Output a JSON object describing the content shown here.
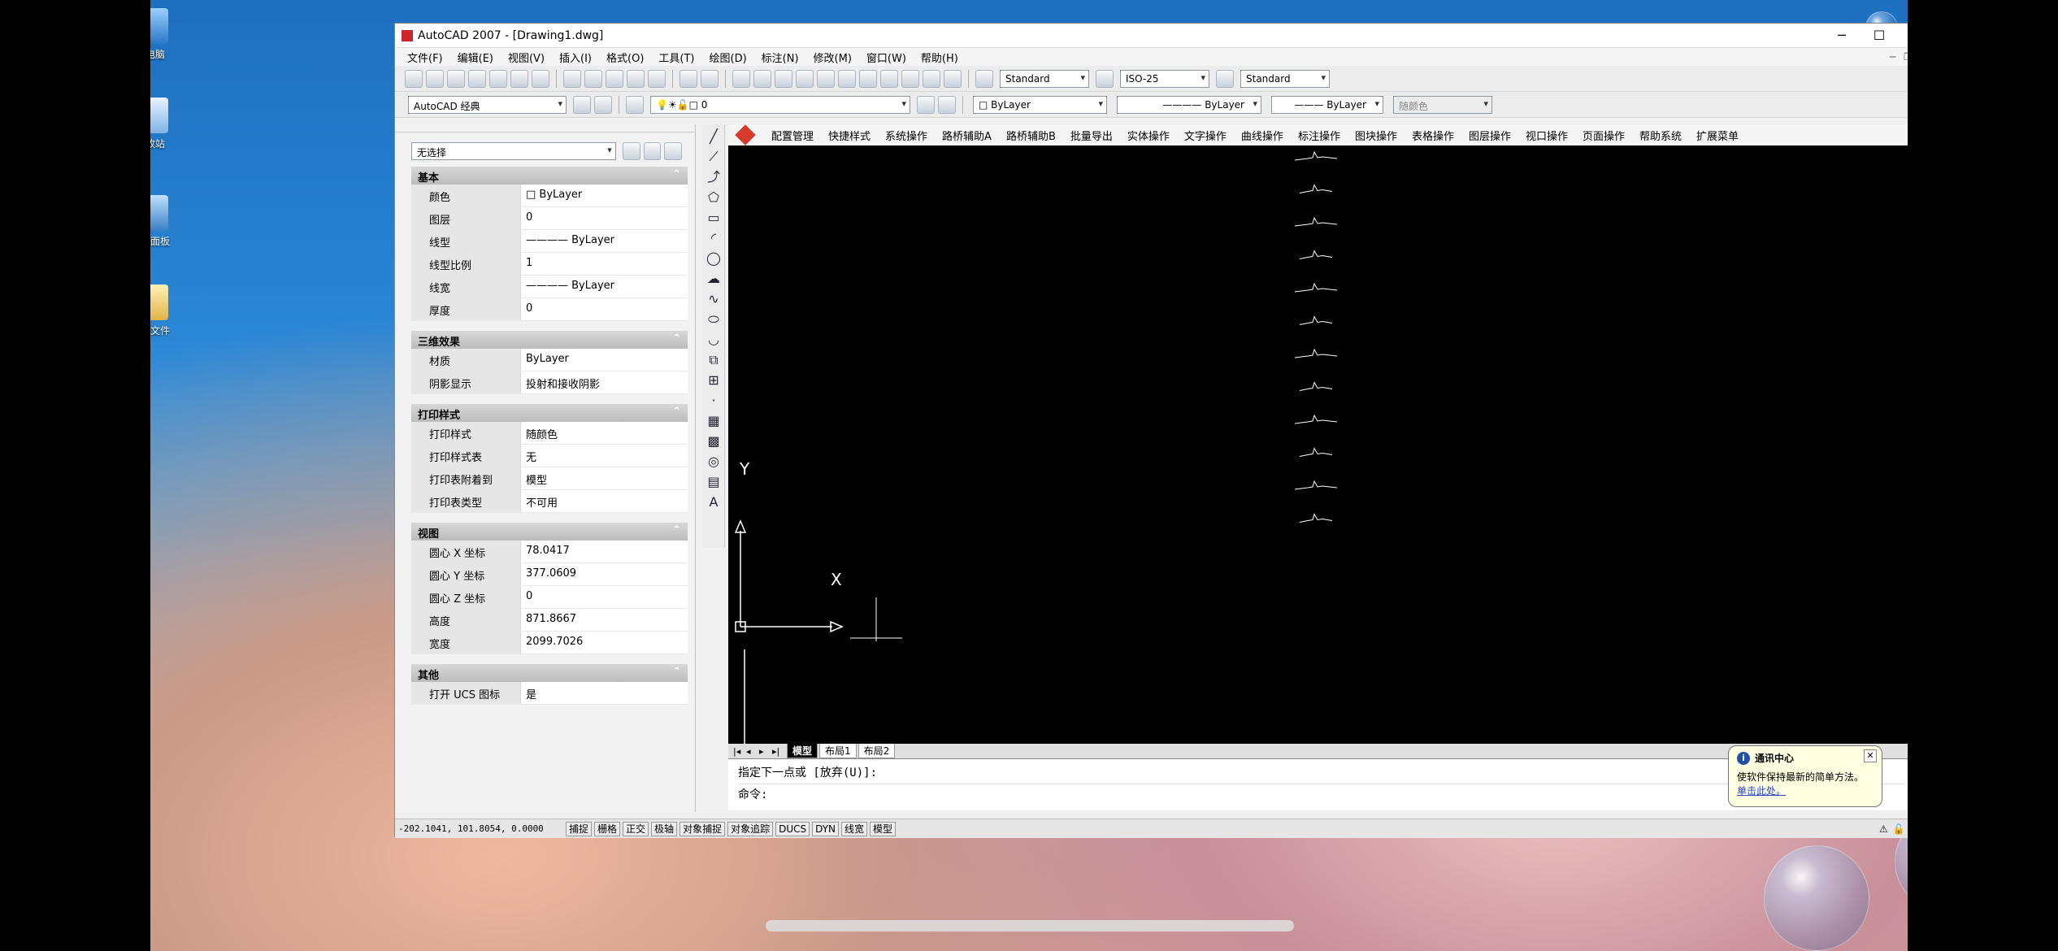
{
  "window": {
    "title": "AutoCAD 2007 - [Drawing1.dwg]",
    "min": "─",
    "max": "☐",
    "close": "✕"
  },
  "desktop_icons": [
    {
      "label": "此电脑"
    },
    {
      "label": "回收站"
    },
    {
      "label": "控制面板"
    },
    {
      "label": "临时文件"
    }
  ],
  "menubar": [
    "文件(F)",
    "编辑(E)",
    "视图(V)",
    "插入(I)",
    "格式(O)",
    "工具(T)",
    "绘图(D)",
    "标注(N)",
    "修改(M)",
    "窗口(W)",
    "帮助(H)"
  ],
  "toolbar": {
    "text_style": "Standard",
    "dim_style": "ISO-25",
    "table_style": "Standard",
    "workspace": "AutoCAD 经典",
    "layer": "0",
    "color": "ByLayer",
    "linetype": "ByLayer",
    "lineweight": "ByLayer",
    "plotstyle": "随颜色"
  },
  "menu2": [
    "配置管理",
    "快捷样式",
    "系统操作",
    "路桥辅助A",
    "路桥辅助B",
    "批量导出",
    "实体操作",
    "文字操作",
    "曲线操作",
    "标注操作",
    "图块操作",
    "表格操作",
    "图层操作",
    "视口操作",
    "页面操作",
    "帮助系统",
    "扩展菜单"
  ],
  "properties": {
    "selection": "无选择",
    "sections": [
      {
        "title": "基本",
        "rows": [
          [
            "颜色",
            "□ ByLayer"
          ],
          [
            "图层",
            "0"
          ],
          [
            "线型",
            "———— ByLayer"
          ],
          [
            "线型比例",
            "1"
          ],
          [
            "线宽",
            "———— ByLayer"
          ],
          [
            "厚度",
            "0"
          ]
        ]
      },
      {
        "title": "三维效果",
        "rows": [
          [
            "材质",
            "ByLayer"
          ],
          [
            "阴影显示",
            "投射和接收阴影"
          ]
        ]
      },
      {
        "title": "打印样式",
        "rows": [
          [
            "打印样式",
            "随颜色"
          ],
          [
            "打印样式表",
            "无"
          ],
          [
            "打印表附着到",
            "模型"
          ],
          [
            "打印表类型",
            "不可用"
          ]
        ]
      },
      {
        "title": "视图",
        "rows": [
          [
            "圆心 X 坐标",
            "78.0417"
          ],
          [
            "圆心 Y 坐标",
            "377.0609"
          ],
          [
            "圆心 Z 坐标",
            "0"
          ],
          [
            "高度",
            "871.8667"
          ],
          [
            "宽度",
            "2099.7026"
          ]
        ]
      },
      {
        "title": "其他",
        "rows": [
          [
            "打开 UCS 图标",
            "是"
          ]
        ]
      }
    ]
  },
  "canvas": {
    "ucs_x": "X",
    "ucs_y": "Y",
    "profile_count": 12
  },
  "tabs": [
    "模型",
    "布局1",
    "布局2"
  ],
  "command": {
    "line1": "指定下一点或 [放弃(U)]:",
    "line2": "命令:"
  },
  "status": {
    "coords": "-202.1041, 101.8054, 0.0000",
    "buttons": [
      "捕捉",
      "栅格",
      "正交",
      "极轴",
      "对象捕捉",
      "对象追踪",
      "DUCS",
      "DYN",
      "线宽",
      "模型"
    ]
  },
  "balloon": {
    "title": "通讯中心",
    "body": "使软件保持最新的简单方法。",
    "link": "单击此处。"
  },
  "colors": {
    "canvas": "#000000",
    "accent": "#1f4fa6"
  }
}
